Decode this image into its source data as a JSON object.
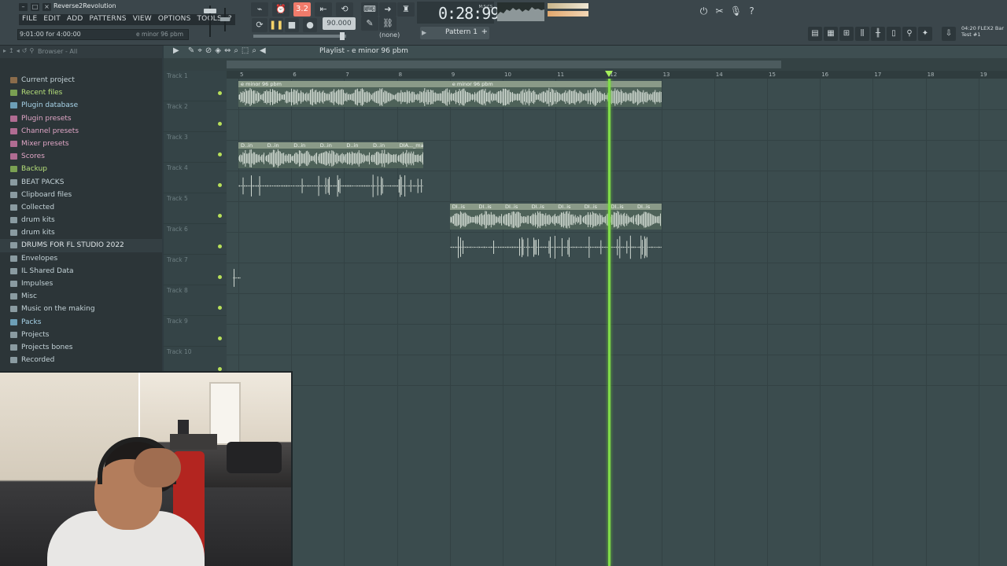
{
  "window": {
    "project_name": "Reverse2Revolution",
    "buttons": [
      "–",
      "□",
      "×"
    ]
  },
  "menu": [
    "FILE",
    "EDIT",
    "ADD",
    "PATTERNS",
    "VIEW",
    "OPTIONS",
    "TOOLS",
    "?"
  ],
  "hint": {
    "left": "9:01:00 for 4:00:00",
    "right": "e minor 96 pbm"
  },
  "transport": {
    "record_count_label": "3.2",
    "tempo": "90.000",
    "snap": "(none)",
    "pattern": "Pattern 1",
    "time": "0:28:99",
    "time_unit": "M:S:CS"
  },
  "flex": {
    "line1": "04:20 FLEX2 Bar",
    "line2": "Test #1"
  },
  "browser": {
    "title": "Browser - All",
    "items": [
      {
        "label": "Current project",
        "color": "#c4d3d8",
        "icon": "#8b6c4b"
      },
      {
        "label": "Recent files",
        "color": "#b6e07a",
        "icon": "#7aa052"
      },
      {
        "label": "Plugin database",
        "color": "#a9d5ea",
        "icon": "#6d9fb7"
      },
      {
        "label": "Plugin presets",
        "color": "#e0a6c6",
        "icon": "#b06c92"
      },
      {
        "label": "Channel presets",
        "color": "#e0a6c6",
        "icon": "#b06c92"
      },
      {
        "label": "Mixer presets",
        "color": "#e0a6c6",
        "icon": "#b06c92"
      },
      {
        "label": "Scores",
        "color": "#e0a6c6",
        "icon": "#b06c92"
      },
      {
        "label": "Backup",
        "color": "#b6e07a",
        "icon": "#7aa052"
      },
      {
        "label": "BEAT PACKS",
        "color": "#c4d3d8",
        "icon": "#8a9ba1"
      },
      {
        "label": "Clipboard files",
        "color": "#c4d3d8",
        "icon": "#8a9ba1"
      },
      {
        "label": "Collected",
        "color": "#c4d3d8",
        "icon": "#8a9ba1"
      },
      {
        "label": "drum kits",
        "color": "#c4d3d8",
        "icon": "#8a9ba1"
      },
      {
        "label": "drum kits",
        "color": "#c4d3d8",
        "icon": "#8a9ba1"
      },
      {
        "label": "DRUMS FOR FL STUDIO 2022",
        "color": "#e1e7e9",
        "icon": "#8a9ba1",
        "selected": true
      },
      {
        "label": "Envelopes",
        "color": "#c4d3d8",
        "icon": "#8a9ba1"
      },
      {
        "label": "IL Shared Data",
        "color": "#c4d3d8",
        "icon": "#8a9ba1"
      },
      {
        "label": "Impulses",
        "color": "#c4d3d8",
        "icon": "#8a9ba1"
      },
      {
        "label": "Misc",
        "color": "#c4d3d8",
        "icon": "#8a9ba1"
      },
      {
        "label": "Music on the making",
        "color": "#c4d3d8",
        "icon": "#8a9ba1"
      },
      {
        "label": "Packs",
        "color": "#a9d5ea",
        "icon": "#6d9fb7"
      },
      {
        "label": "Projects",
        "color": "#c4d3d8",
        "icon": "#8a9ba1"
      },
      {
        "label": "Projects bones",
        "color": "#c4d3d8",
        "icon": "#8a9ba1"
      },
      {
        "label": "Recorded",
        "color": "#c4d3d8",
        "icon": "#8a9ba1"
      }
    ]
  },
  "playlist": {
    "title": "Playlist - e minor 96 pbm",
    "bars": [
      "5",
      "6",
      "7",
      "8",
      "9",
      "10",
      "11",
      "12",
      "13",
      "14",
      "15",
      "16",
      "17",
      "18",
      "19"
    ],
    "tracks": [
      "Track 1",
      "Track 2",
      "Track 3",
      "Track 4",
      "Track 5",
      "Track 6",
      "Track 7",
      "Track 8",
      "Track 9",
      "Track 10"
    ],
    "clip_labels": {
      "main_a": "e minor 96 pbm",
      "main_b": "e minor 96 pbm",
      "drum_short": "D..in",
      "drum_last": "DIA..._main",
      "loop_short": "DI..is"
    },
    "playhead_bar": 12.0
  },
  "colors": {
    "playhead": "#80dc4a",
    "clip_head": "#8a9a88",
    "grid_bg": "#3b4c4e"
  }
}
